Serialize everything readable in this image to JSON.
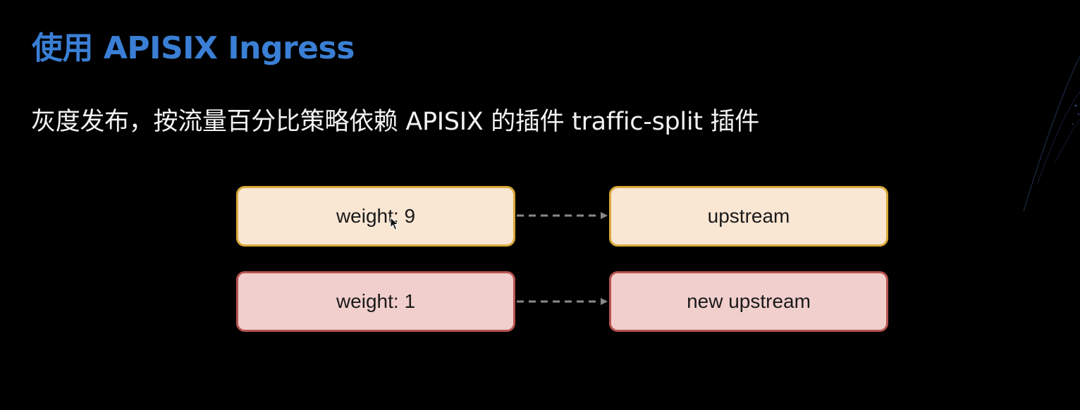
{
  "slide": {
    "title": "使用 APISIX Ingress",
    "subtitle": "灰度发布，按流量百分比策略依赖 APISIX 的插件 traffic-split 插件",
    "colors": {
      "background": "#000000",
      "title": "#3a7fd5",
      "subtitle": "#f2f2f2",
      "orange_fill": "#f9e6d3",
      "orange_border": "#d9a93a",
      "red_fill": "#f1cfcd",
      "red_border": "#b85450",
      "arrow": "#8a8a8a"
    }
  },
  "diagram": {
    "nodes": [
      {
        "id": "weight-9",
        "label": "weight: 9",
        "style": "orange"
      },
      {
        "id": "upstream",
        "label": "upstream",
        "style": "orange"
      },
      {
        "id": "weight-1",
        "label": "weight: 1",
        "style": "red"
      },
      {
        "id": "new-upstream",
        "label": "new upstream",
        "style": "red"
      }
    ],
    "edges": [
      {
        "from": "weight-9",
        "to": "upstream",
        "style": "dashed"
      },
      {
        "from": "weight-1",
        "to": "new-upstream",
        "style": "dashed"
      }
    ]
  }
}
